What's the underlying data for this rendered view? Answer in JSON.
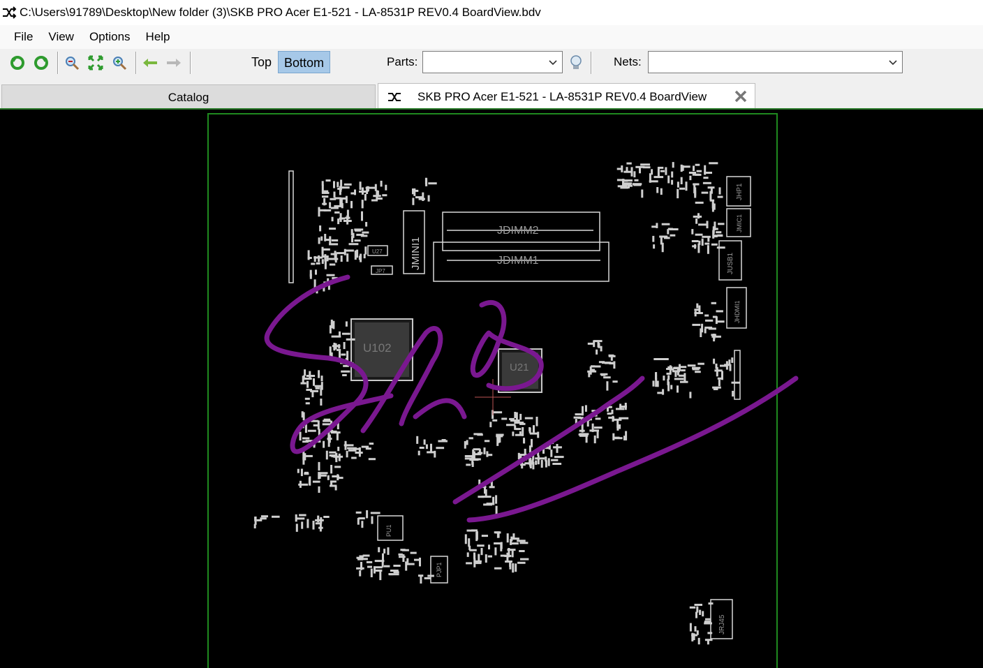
{
  "window": {
    "title": "C:\\Users\\91789\\Desktop\\New folder (3)\\SKB PRO Acer E1-521 - LA-8531P REV0.4 BoardView.bdv"
  },
  "menu": [
    "File",
    "View",
    "Options",
    "Help"
  ],
  "toolbar": {
    "side_top": "Top",
    "side_bottom": "Bottom",
    "active_side": "Bottom",
    "parts_label": "Parts:",
    "parts_value": "",
    "nets_label": "Nets:",
    "nets_value": ""
  },
  "tabs": {
    "catalog": "Catalog",
    "board": "SKB PRO Acer E1-521 - LA-8531P REV0.4 BoardView"
  },
  "board": {
    "outline_color": "#1f8a1f",
    "annotation_color": "#7a1890",
    "labels": [
      "JDIMM2",
      "JDIMM1",
      "JMINI1",
      "U102",
      "U21",
      "JHP1",
      "JMIC1",
      "JUSB1",
      "JHDMI1",
      "JRJ45",
      "PJP1",
      "PU1",
      "U27",
      "JP7"
    ]
  }
}
